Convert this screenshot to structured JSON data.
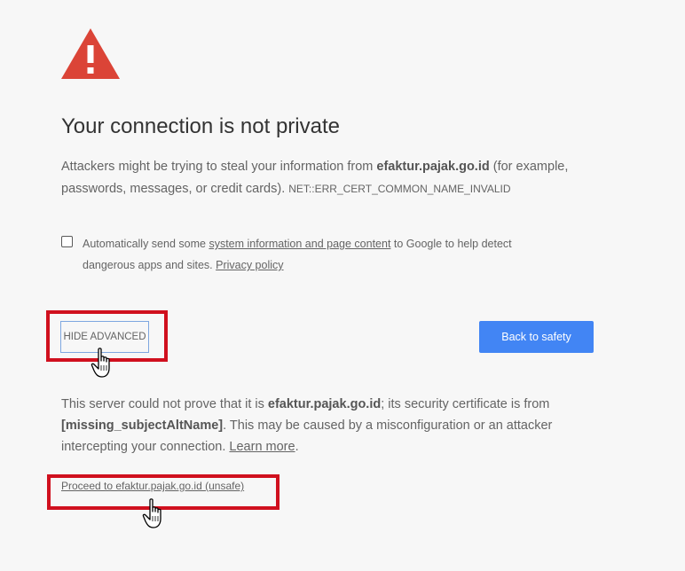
{
  "page": {
    "title": "Your connection is not private",
    "icon": "warning-triangle-icon"
  },
  "main_message": {
    "prefix": "Attackers might be trying to steal your information from ",
    "domain": "efaktur.pajak.go.id",
    "suffix": " (for example, passwords, messages, or credit cards). ",
    "error_code": "NET::ERR_CERT_COMMON_NAME_INVALID"
  },
  "optin": {
    "checked": false,
    "prefix": "Automatically send some ",
    "link_text": "system information and page content",
    "middle": " to Google to help detect dangerous apps and sites. ",
    "privacy_link": "Privacy policy"
  },
  "buttons": {
    "hide_advanced": "HIDE ADVANCED",
    "back_to_safety": "Back to safety"
  },
  "details": {
    "part1": "This server could not prove that it is ",
    "domain": "efaktur.pajak.go.id",
    "part2": "; its security certificate is from ",
    "cert_name": "[missing_subjectAltName]",
    "part3": ". This may be caused by a misconfiguration or an attacker intercepting your connection. ",
    "learn_more": "Learn more",
    "part4": "."
  },
  "proceed_link": "Proceed to efaktur.pajak.go.id (unsafe)",
  "colors": {
    "background": "#f7f7f7",
    "warning_red": "#db4437",
    "primary_button": "#4285f4",
    "annotation_red": "#d0101e"
  }
}
